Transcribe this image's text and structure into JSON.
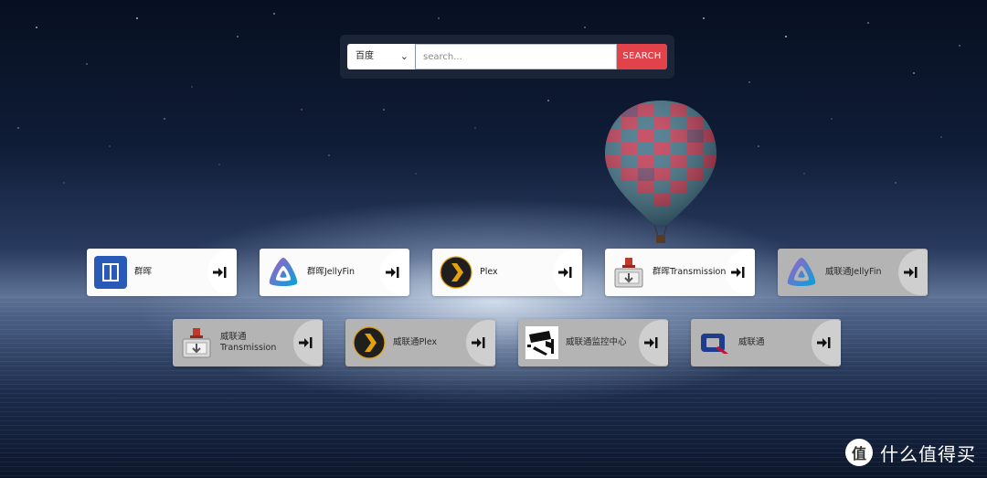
{
  "search": {
    "engine": "百度",
    "placeholder": "search...",
    "button_label": "SEARCH"
  },
  "cards": [
    {
      "label": "群晖",
      "icon": "synology-icon",
      "style": "white"
    },
    {
      "label": "群晖JellyFin",
      "icon": "jellyfin-icon",
      "style": "white"
    },
    {
      "label": "Plex",
      "icon": "plex-icon",
      "style": "white"
    },
    {
      "label": "群晖Transmission",
      "icon": "transmission-icon",
      "style": "white"
    },
    {
      "label": "威联通JellyFin",
      "icon": "jellyfin-icon",
      "style": "gray"
    },
    {
      "label": "威联通\nTransmission",
      "icon": "transmission-icon",
      "style": "gray"
    },
    {
      "label": "威联通Plex",
      "icon": "plex-icon",
      "style": "gray"
    },
    {
      "label": "威联通监控中心",
      "icon": "surveillance-camera-icon",
      "style": "gray"
    },
    {
      "label": "威联通",
      "icon": "qnap-icon",
      "style": "gray"
    }
  ],
  "watermark": {
    "symbol": "值",
    "text": "什么值得买"
  },
  "colors": {
    "search_button": "#e2424a",
    "card_white": "#fbfbfb",
    "card_gray": "#b4b4b4"
  }
}
